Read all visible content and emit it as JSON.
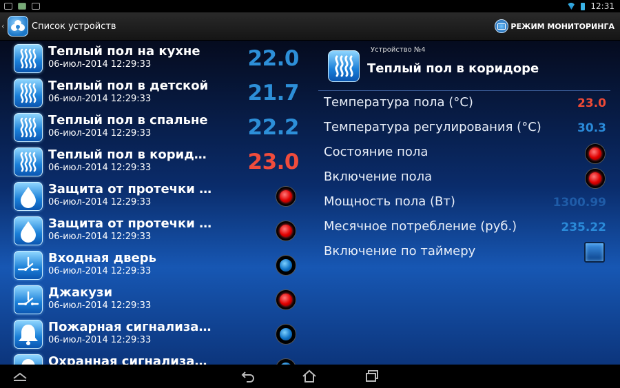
{
  "status": {
    "time": "12:31"
  },
  "actionbar": {
    "title": "Список устройств",
    "monitor_label": "РЕЖИМ МОНИТОРИНГА"
  },
  "colors": {
    "value_blue": "#2d8fd8",
    "value_red": "#f04c3c",
    "detail_blue": "#2a8ad9",
    "detail_red": "#ee4a36",
    "detail_dim": "#1f5ca8"
  },
  "devices": [
    {
      "name": "Теплый пол на кухне",
      "time": "06-июл-2014 12:29:33",
      "value": "22.0",
      "kind": "floor",
      "value_color": "blue"
    },
    {
      "name": "Теплый пол в детской",
      "time": "06-июл-2014 12:29:33",
      "value": "21.7",
      "kind": "floor",
      "value_color": "blue"
    },
    {
      "name": "Теплый пол в спальне",
      "time": "06-июл-2014 12:29:33",
      "value": "22.2",
      "kind": "floor",
      "value_color": "blue"
    },
    {
      "name": "Теплый пол в коридоре",
      "time": "06-июл-2014 12:29:33",
      "value": "23.0",
      "kind": "floor",
      "value_color": "red"
    },
    {
      "name": "Защита от протечки ва…",
      "time": "06-июл-2014 12:29:33",
      "indicator": "red",
      "kind": "drop"
    },
    {
      "name": "Защита от протечки ку…",
      "time": "06-июл-2014 12:29:33",
      "indicator": "red",
      "kind": "drop"
    },
    {
      "name": "Входная дверь",
      "time": "06-июл-2014 12:29:33",
      "indicator": "blue",
      "kind": "switch"
    },
    {
      "name": "Джакузи",
      "time": "06-июл-2014 12:29:33",
      "indicator": "red",
      "kind": "switch"
    },
    {
      "name": "Пожарная сигнализация",
      "time": "06-июл-2014 12:29:33",
      "indicator": "blue",
      "kind": "bell"
    },
    {
      "name": "Охранная сигнализация",
      "time": "",
      "indicator": "blue",
      "kind": "bell"
    }
  ],
  "detail": {
    "subtitle": "Устройство №4",
    "title": "Теплый пол в коридоре",
    "rows": [
      {
        "label": "Температура пола (°C)",
        "value": "23.0",
        "color": "red"
      },
      {
        "label": "Температура регулирования (°C)",
        "value": "30.3",
        "color": "blue"
      },
      {
        "label": "Состояние пола",
        "indicator": "red"
      },
      {
        "label": "Включение пола",
        "indicator": "red"
      },
      {
        "label": "Мощность пола (Вт)",
        "value": "1300.99",
        "color": "dim"
      },
      {
        "label": "Месячное потребление (руб.)",
        "value": "235.22",
        "color": "blue"
      },
      {
        "label": "Включение по таймеру",
        "toggle": "on"
      }
    ]
  }
}
